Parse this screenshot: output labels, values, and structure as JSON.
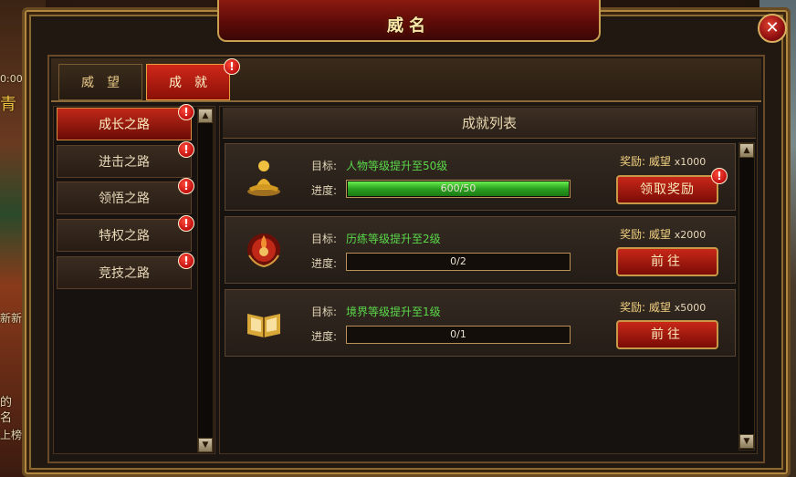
{
  "window": {
    "title": "威名",
    "close_label": "✕"
  },
  "background": {
    "left_texts": [
      "0:00",
      "青",
      "新新",
      "的",
      "名",
      "上榜"
    ]
  },
  "tabs": [
    {
      "label": "威望",
      "active": false,
      "badge": ""
    },
    {
      "label": "成就",
      "active": true,
      "badge": "!"
    }
  ],
  "nav": [
    {
      "label": "成长之路",
      "active": true,
      "badge": "!"
    },
    {
      "label": "进击之路",
      "active": false,
      "badge": "!"
    },
    {
      "label": "领悟之路",
      "active": false,
      "badge": "!"
    },
    {
      "label": "特权之路",
      "active": false,
      "badge": "!"
    },
    {
      "label": "竞技之路",
      "active": false,
      "badge": "!"
    }
  ],
  "list": {
    "header": "成就列表",
    "goal_label": "目标:",
    "progress_label": "进度:",
    "reward_label": "奖励:",
    "items": [
      {
        "icon": "golden-buddha-icon",
        "goal": "人物等级提升至50级",
        "progress_text": "600/50",
        "progress_fraction": 1.0,
        "reward_name": "威望",
        "reward_amount": "x1000",
        "button": "领取奖励",
        "badge": "!"
      },
      {
        "icon": "red-flame-emblem-icon",
        "goal": "历练等级提升至2级",
        "progress_text": "0/2",
        "progress_fraction": 0.0,
        "reward_name": "威望",
        "reward_amount": "x2000",
        "button": "前往",
        "badge": ""
      },
      {
        "icon": "golden-book-icon",
        "goal": "境界等级提升至1级",
        "progress_text": "0/1",
        "progress_fraction": 0.0,
        "reward_name": "威望",
        "reward_amount": "x5000",
        "button": "前往",
        "badge": ""
      }
    ]
  },
  "scroll": {
    "up": "▲",
    "down": "▼"
  }
}
